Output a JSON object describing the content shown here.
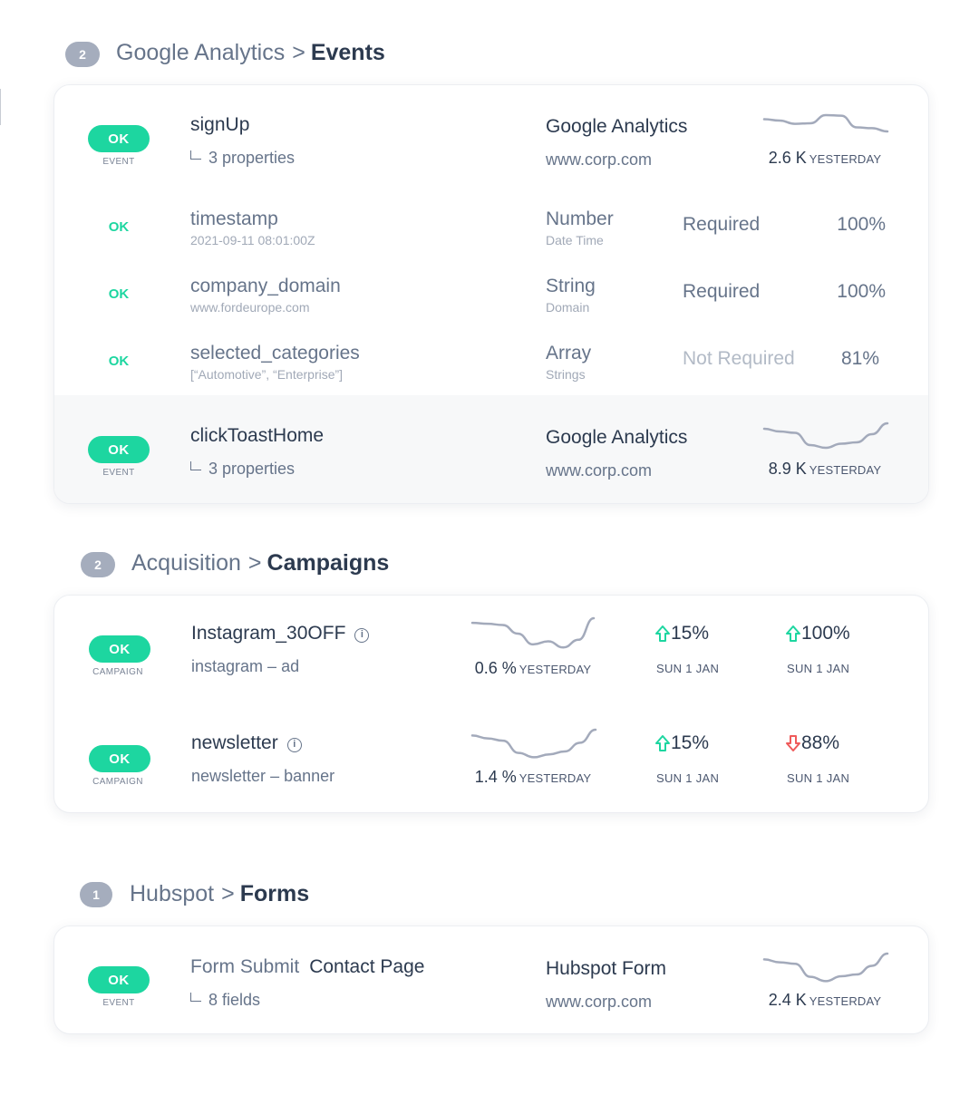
{
  "colors": {
    "ok": "#1dd6a0",
    "badge": "#a5adbd",
    "up": "#1dd6a0",
    "down": "#ef5a5a",
    "spark": "#a3aabb"
  },
  "sections": [
    {
      "count": "2",
      "crumb": "Google Analytics",
      "separator": ">",
      "current": "Events",
      "events": [
        {
          "status": "OK",
          "kind": "EVENT",
          "name": "signUp",
          "detail": "3 properties",
          "source": "Google Analytics",
          "domain": "www.corp.com",
          "metric": "2.6 K",
          "metric_label": "YESTERDAY",
          "sparkline": [
            0.25,
            0.3,
            0.42,
            0.4,
            0.1,
            0.12,
            0.55,
            0.58,
            0.7
          ]
        },
        {
          "status": "OK",
          "kind": "EVENT",
          "name": "clickToastHome",
          "detail": "3 properties",
          "source": "Google Analytics",
          "domain": "www.corp.com",
          "metric": "8.9 K",
          "metric_label": "YESTERDAY",
          "sparkline": [
            0.2,
            0.3,
            0.35,
            0.8,
            0.9,
            0.75,
            0.7,
            0.4,
            0.0
          ]
        }
      ],
      "properties": [
        {
          "status": "OK",
          "name": "timestamp",
          "example": "2021-09-11 08:01:00Z",
          "type": "Number",
          "subtype": "Date Time",
          "requirement": "Required",
          "coverage": "100%"
        },
        {
          "status": "OK",
          "name": "company_domain",
          "example": "www.fordeurope.com",
          "type": "String",
          "subtype": "Domain",
          "requirement": "Required",
          "coverage": "100%"
        },
        {
          "status": "OK",
          "name": "selected_categories",
          "example": "[“Automotive”, “Enterprise”]",
          "type": "Array",
          "subtype": "Strings",
          "requirement": "Not Required",
          "coverage": "81%"
        }
      ]
    },
    {
      "count": "2",
      "crumb": "Acquisition",
      "separator": ">",
      "current": "Campaigns",
      "campaigns": [
        {
          "status": "OK",
          "kind": "CAMPAIGN",
          "name": "Instagram_30OFF",
          "source": "instagram",
          "dash": "–",
          "medium": "ad",
          "metric": "0.6 %",
          "metric_label": "YESTERDAY",
          "delta1": "15%",
          "delta1_dir": "up",
          "delta1_date": "SUN 1 JAN",
          "delta2": "100%",
          "delta2_dir": "up",
          "delta2_date": "SUN 1 JAN",
          "sparkline": [
            0.15,
            0.18,
            0.22,
            0.5,
            0.85,
            0.75,
            0.95,
            0.7,
            0.0
          ]
        },
        {
          "status": "OK",
          "kind": "CAMPAIGN",
          "name": "newsletter",
          "source": "newsletter",
          "dash": "–",
          "medium": "banner",
          "metric": "1.4 %",
          "metric_label": "YESTERDAY",
          "delta1": "15%",
          "delta1_dir": "up",
          "delta1_date": "SUN 1 JAN",
          "delta2": "88%",
          "delta2_dir": "down",
          "delta2_date": "SUN 1 JAN",
          "sparkline": [
            0.2,
            0.3,
            0.38,
            0.8,
            0.95,
            0.85,
            0.75,
            0.45,
            0.0
          ]
        }
      ]
    },
    {
      "count": "1",
      "crumb": "Hubspot",
      "separator": ">",
      "current": "Forms",
      "forms": [
        {
          "status": "OK",
          "kind": "EVENT",
          "name": "Form Submit",
          "page": "Contact Page",
          "detail": "8 fields",
          "source": "Hubspot Form",
          "domain": "www.corp.com",
          "metric": "2.4 K",
          "metric_label": "YESTERDAY",
          "sparkline": [
            0.2,
            0.3,
            0.35,
            0.8,
            0.95,
            0.78,
            0.72,
            0.42,
            0.0
          ]
        }
      ]
    }
  ]
}
